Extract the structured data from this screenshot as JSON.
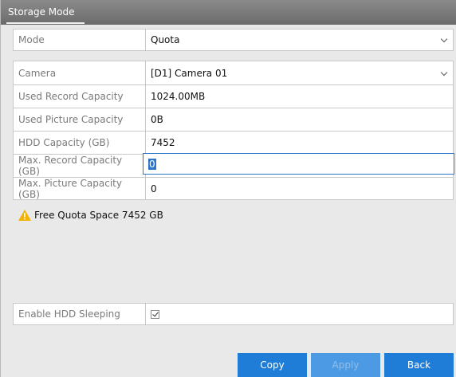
{
  "window": {
    "title": "Storage Mode"
  },
  "mode": {
    "label": "Mode",
    "value": "Quota"
  },
  "camera": {
    "label": "Camera",
    "value": "[D1] Camera 01"
  },
  "used_record": {
    "label": "Used Record Capacity",
    "value": "1024.00MB"
  },
  "used_picture": {
    "label": "Used Picture Capacity",
    "value": "0B"
  },
  "hdd_capacity": {
    "label": "HDD Capacity (GB)",
    "value": "7452"
  },
  "max_record": {
    "label": "Max. Record Capacity (GB)",
    "value": "0"
  },
  "max_picture": {
    "label": "Max. Picture Capacity (GB)",
    "value": "0"
  },
  "warning": {
    "text": "Free Quota Space 7452 GB",
    "icon": "warning-icon"
  },
  "hdd_sleeping": {
    "label": "Enable HDD Sleeping",
    "checked": true
  },
  "buttons": {
    "copy": "Copy",
    "apply": "Apply",
    "back": "Back"
  },
  "colors": {
    "accent": "#1f7cd7",
    "titlebar": "#7a7a7a",
    "focus": "#2a74c9"
  }
}
